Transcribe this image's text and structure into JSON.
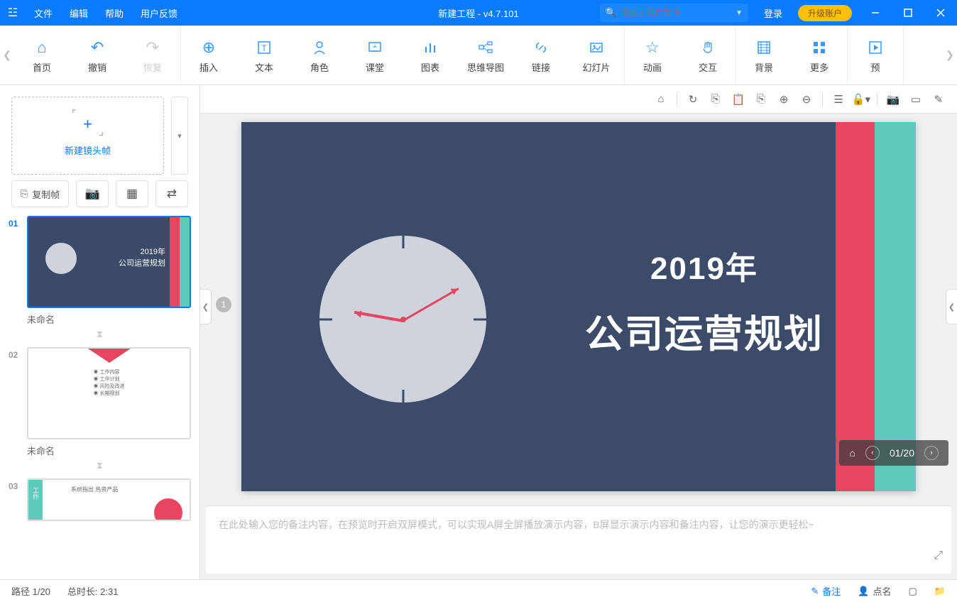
{
  "titlebar": {
    "menus": [
      "文件",
      "编辑",
      "帮助",
      "用户反馈"
    ],
    "app_title": "新建工程 - v4.7.101",
    "search_placeholder": "搜索工程内文件",
    "login": "登录",
    "upgrade": "升级账户"
  },
  "ribbon": {
    "groups": [
      [
        {
          "icon": "home",
          "label": "首页"
        },
        {
          "icon": "undo",
          "label": "撤销"
        },
        {
          "icon": "redo",
          "label": "恢复",
          "disabled": true
        }
      ],
      [
        {
          "icon": "plus-circle",
          "label": "插入"
        },
        {
          "icon": "text",
          "label": "文本"
        },
        {
          "icon": "person",
          "label": "角色"
        },
        {
          "icon": "class",
          "label": "课堂"
        },
        {
          "icon": "chart",
          "label": "图表"
        },
        {
          "icon": "mindmap",
          "label": "思维导图"
        },
        {
          "icon": "link",
          "label": "链接"
        },
        {
          "icon": "slides",
          "label": "幻灯片"
        }
      ],
      [
        {
          "icon": "anim",
          "label": "动画"
        },
        {
          "icon": "interact",
          "label": "交互"
        }
      ],
      [
        {
          "icon": "bg",
          "label": "背景"
        },
        {
          "icon": "more",
          "label": "更多"
        }
      ],
      [
        {
          "icon": "preview",
          "label": "预"
        }
      ]
    ]
  },
  "sidebar": {
    "new_frame": "新建镜头帧",
    "copy_frame": "复制帧",
    "slides": [
      {
        "num": "01",
        "label": "未命名",
        "title_l1": "2019年",
        "title_l2": "公司运营规划",
        "active": true
      },
      {
        "num": "02",
        "label": "未命名",
        "active": false
      },
      {
        "num": "03",
        "label": "",
        "active": false
      }
    ]
  },
  "canvas": {
    "title_l1": "2019年",
    "title_l2": "公司运营规划",
    "step": "1",
    "page_indicator": "01/20"
  },
  "notes": {
    "placeholder": "在此处输入您的备注内容，在预览时开启双屏模式，可以实现A屏全屏播放演示内容，B屏显示演示内容和备注内容，让您的演示更轻松~"
  },
  "statusbar": {
    "path": "路径 1/20",
    "duration": "总时长: 2:31",
    "notes_btn": "备注",
    "roll_btn": "点名"
  }
}
